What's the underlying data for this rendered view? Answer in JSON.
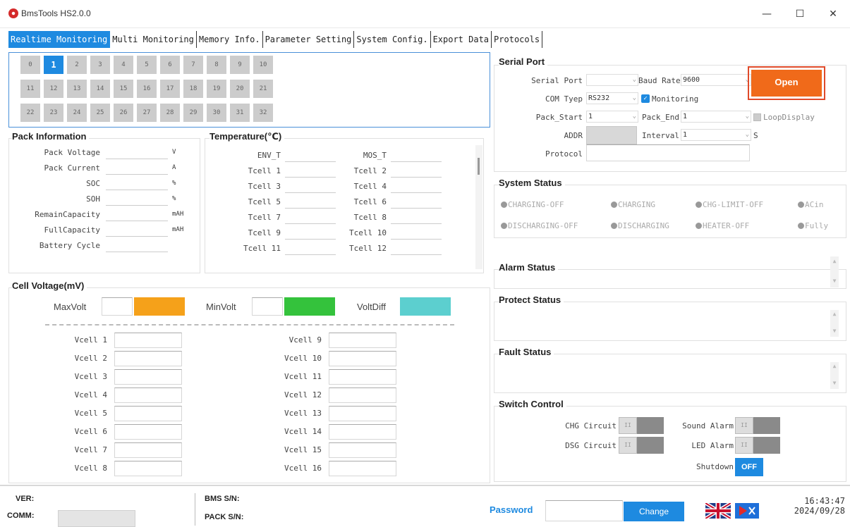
{
  "window": {
    "title": "BmsTools HS2.0.0",
    "minimize": "—",
    "maximize": "☐",
    "close": "✕"
  },
  "tabs": [
    "Realtime Monitoring",
    "Multi Monitoring",
    "Memory Info.",
    "Parameter Setting",
    "System Config.",
    "Export Data",
    "Protocols"
  ],
  "pack_grid": {
    "rows": [
      [
        "0",
        "1",
        "2",
        "3",
        "4",
        "5",
        "6",
        "7",
        "8",
        "9",
        "10"
      ],
      [
        "11",
        "12",
        "13",
        "14",
        "15",
        "16",
        "17",
        "18",
        "19",
        "20",
        "21"
      ],
      [
        "22",
        "23",
        "24",
        "25",
        "26",
        "27",
        "28",
        "29",
        "30",
        "31",
        "32"
      ]
    ],
    "selected": "1"
  },
  "pack_info": {
    "title": "Pack Information",
    "rows": [
      {
        "label": "Pack Voltage",
        "unit": "V"
      },
      {
        "label": "Pack Current",
        "unit": "A"
      },
      {
        "label": "SOC",
        "unit": "%"
      },
      {
        "label": "SOH",
        "unit": "%"
      },
      {
        "label": "RemainCapacity",
        "unit": "mAH"
      },
      {
        "label": "FullCapacity",
        "unit": "mAH"
      },
      {
        "label": "Battery Cycle",
        "unit": ""
      }
    ]
  },
  "temperature": {
    "title": "Temperature(℃)",
    "left": [
      "ENV_T",
      "Tcell 1",
      "Tcell 3",
      "Tcell 5",
      "Tcell 7",
      "Tcell 9",
      "Tcell 11"
    ],
    "right": [
      "MOS_T",
      "Tcell 2",
      "Tcell 4",
      "Tcell 6",
      "Tcell 8",
      "Tcell 10",
      "Tcell 12"
    ]
  },
  "cell_voltage": {
    "title": "Cell Voltage(mV)",
    "max_label": "MaxVolt",
    "min_label": "MinVolt",
    "diff_label": "VoltDiff",
    "left": [
      "Vcell 1",
      "Vcell 2",
      "Vcell 3",
      "Vcell 4",
      "Vcell 5",
      "Vcell 6",
      "Vcell 7",
      "Vcell 8"
    ],
    "right": [
      "Vcell 9",
      "Vcell 10",
      "Vcell 11",
      "Vcell 12",
      "Vcell 13",
      "Vcell 14",
      "Vcell 15",
      "Vcell 16"
    ]
  },
  "serial_port": {
    "title": "Serial Port",
    "serial_port_label": "Serial Port",
    "serial_port_value": "",
    "baud_rate_label": "Baud Rate",
    "baud_rate_value": "9600",
    "com_type_label": "COM Tyep",
    "com_type_value": "RS232",
    "monitoring_label": "Monitoring",
    "pack_start_label": "Pack_Start",
    "pack_start_value": "1",
    "pack_end_label": "Pack_End",
    "pack_end_value": "1",
    "loop_display_label": "LoopDisplay",
    "addr_label": "ADDR",
    "interval_label": "Interval",
    "interval_value": "1",
    "interval_unit": "S",
    "protocol_label": "Protocol",
    "open_button": "Open"
  },
  "system_status": {
    "title": "System Status",
    "row1": [
      "CHARGING-OFF",
      "CHARGING",
      "CHG-LIMIT-OFF",
      "ACin"
    ],
    "row2": [
      "DISCHARGING-OFF",
      "DISCHARGING",
      "HEATER-OFF",
      "Fully"
    ]
  },
  "alarm_status": {
    "title": "Alarm Status"
  },
  "protect_status": {
    "title": "Protect Status"
  },
  "fault_status": {
    "title": "Fault Status"
  },
  "switch_control": {
    "title": "Switch Control",
    "chg_circuit": "CHG Circuit",
    "dsg_circuit": "DSG Circuit",
    "sound_alarm": "Sound Alarm",
    "led_alarm": "LED Alarm",
    "shutdown_label": "Shutdown",
    "shutdown_button": "OFF",
    "toggle_glyph": "II"
  },
  "footer": {
    "ver_label": "VER:",
    "comm_label": "COMM:",
    "bms_sn_label": "BMS S/N:",
    "pack_sn_label": "PACK S/N:",
    "password_label": "Password",
    "change_button": "Change",
    "time": "16:43:47",
    "date": "2024/09/28"
  },
  "colors": {
    "accent": "#1e8ae0",
    "open_button": "#f06a1a",
    "max_volt": "#f5a11a",
    "min_volt": "#34c23c",
    "volt_diff": "#5ccfcf"
  }
}
